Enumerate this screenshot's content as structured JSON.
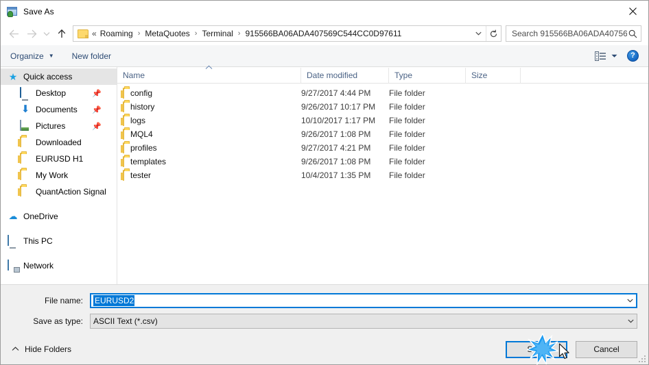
{
  "window": {
    "title": "Save As",
    "icon": "save-as-app-icon",
    "close_label": "✕"
  },
  "address_bar": {
    "back_icon": "arrow-left-icon",
    "forward_icon": "arrow-right-icon",
    "recent_icon": "chevron-down-icon",
    "up_icon": "arrow-up-icon",
    "folder_icon": "folder-icon",
    "leading_separator": "«",
    "crumbs": [
      "Roaming",
      "MetaQuotes",
      "Terminal",
      "915566BA06ADA407569C544CC0D97611"
    ],
    "separator": "›",
    "dropdown_icon": "chevron-down-icon",
    "refresh_icon": "refresh-icon",
    "search_placeholder": "Search 915566BA06ADA40756...",
    "search_icon": "search-icon"
  },
  "command_bar": {
    "organize_label": "Organize",
    "organize_caret": "▼",
    "new_folder_label": "New folder",
    "view_icon": "list-view-icon",
    "view_caret": "▼",
    "help_label": "?"
  },
  "sidebar": {
    "items": [
      {
        "label": "Quick access",
        "icon": "star-icon",
        "indent": false,
        "selected": true,
        "pinned": false
      },
      {
        "label": "Desktop",
        "icon": "monitor-icon",
        "indent": true,
        "selected": false,
        "pinned": true
      },
      {
        "label": "Documents",
        "icon": "download-arrow-icon",
        "indent": true,
        "selected": false,
        "pinned": true
      },
      {
        "label": "Pictures",
        "icon": "pictures-icon",
        "indent": true,
        "selected": false,
        "pinned": true
      },
      {
        "label": "Downloaded",
        "icon": "folder-icon",
        "indent": true,
        "selected": false,
        "pinned": false
      },
      {
        "label": "EURUSD H1",
        "icon": "folder-icon",
        "indent": true,
        "selected": false,
        "pinned": false
      },
      {
        "label": "My Work",
        "icon": "folder-icon",
        "indent": true,
        "selected": false,
        "pinned": false
      },
      {
        "label": "QuantAction Signal",
        "icon": "folder-icon",
        "indent": true,
        "selected": false,
        "pinned": false
      },
      {
        "label": "OneDrive",
        "icon": "cloud-icon",
        "indent": false,
        "selected": false,
        "pinned": false,
        "spacer": true
      },
      {
        "label": "This PC",
        "icon": "pc-icon",
        "indent": false,
        "selected": false,
        "pinned": false,
        "spacer": true
      },
      {
        "label": "Network",
        "icon": "network-icon",
        "indent": false,
        "selected": false,
        "pinned": false,
        "spacer": true
      }
    ],
    "pin_icon": "pin-icon"
  },
  "file_list": {
    "columns": [
      "Name",
      "Date modified",
      "Type",
      "Size"
    ],
    "sort_indicator": "︿",
    "rows": [
      {
        "name": "config",
        "date": "9/27/2017 4:44 PM",
        "type": "File folder",
        "size": "",
        "icon": "folder-icon"
      },
      {
        "name": "history",
        "date": "9/26/2017 10:17 PM",
        "type": "File folder",
        "size": "",
        "icon": "folder-icon"
      },
      {
        "name": "logs",
        "date": "10/10/2017 1:17 PM",
        "type": "File folder",
        "size": "",
        "icon": "folder-icon"
      },
      {
        "name": "MQL4",
        "date": "9/26/2017 1:08 PM",
        "type": "File folder",
        "size": "",
        "icon": "folder-icon"
      },
      {
        "name": "profiles",
        "date": "9/27/2017 4:21 PM",
        "type": "File folder",
        "size": "",
        "icon": "folder-icon"
      },
      {
        "name": "templates",
        "date": "9/26/2017 1:08 PM",
        "type": "File folder",
        "size": "",
        "icon": "folder-icon"
      },
      {
        "name": "tester",
        "date": "10/4/2017 1:35 PM",
        "type": "File folder",
        "size": "",
        "icon": "folder-icon"
      }
    ]
  },
  "form": {
    "file_name_label": "File name:",
    "file_name_value": "EURUSD2",
    "file_name_dropdown_icon": "chevron-down-icon",
    "save_as_type_label": "Save as type:",
    "save_as_type_value": "ASCII Text (*.csv)",
    "save_as_type_dropdown_icon": "chevron-down-icon"
  },
  "footer": {
    "hide_folders_label": "Hide Folders",
    "hide_folders_icon": "chevron-up-icon",
    "save_label": "Save",
    "cancel_label": "Cancel",
    "resize_grip_icon": "resize-grip-icon",
    "click_effect_icon": "click-burst-icon",
    "cursor_icon": "mouse-cursor-icon"
  },
  "colors": {
    "accent": "#0078d7",
    "folder": "#ffd95e",
    "header_text": "#4a6285",
    "command_text": "#2c4a73"
  }
}
